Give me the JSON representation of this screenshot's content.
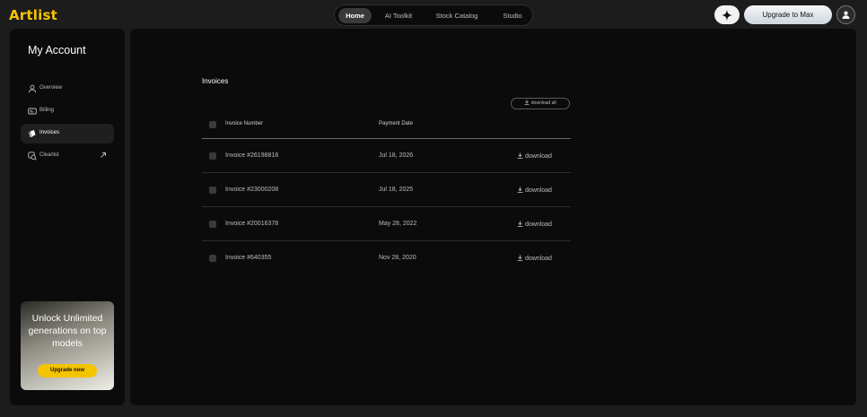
{
  "app": {
    "logo": "Artlist"
  },
  "nav": {
    "tabs": [
      "Home",
      "AI Toolkit",
      "Stock Catalog",
      "Studio"
    ]
  },
  "header": {
    "upgrade_label": "Upgrade to Max"
  },
  "sidebar": {
    "title": "My Account",
    "items": [
      {
        "label": "Overview",
        "icon": "user-icon"
      },
      {
        "label": "Billing",
        "icon": "billing-icon"
      },
      {
        "label": "Invoices",
        "icon": "invoices-icon",
        "active": true
      },
      {
        "label": "Clearlist",
        "icon": "clearlist-icon",
        "external": true
      }
    ],
    "promo": {
      "text": "Unlock Unlimited generations on top models",
      "button": "Upgrade now"
    }
  },
  "invoices": {
    "title": "Invoices",
    "download_all": "download all",
    "columns": [
      "Invoice Number",
      "Payment Date"
    ],
    "rows": [
      {
        "number": "Invoice #26198818",
        "date": "Jul 18, 2026",
        "action": "download"
      },
      {
        "number": "Invoice #23000208",
        "date": "Jul 18, 2025",
        "action": "download"
      },
      {
        "number": "Invoice #20016378",
        "date": "May 28, 2022",
        "action": "download"
      },
      {
        "number": "Invoice #640355",
        "date": "Nov 28, 2020",
        "action": "download"
      }
    ]
  },
  "colors": {
    "accent": "#f5c400",
    "background": "#0b0b0b",
    "frame": "#1c1c1c"
  }
}
